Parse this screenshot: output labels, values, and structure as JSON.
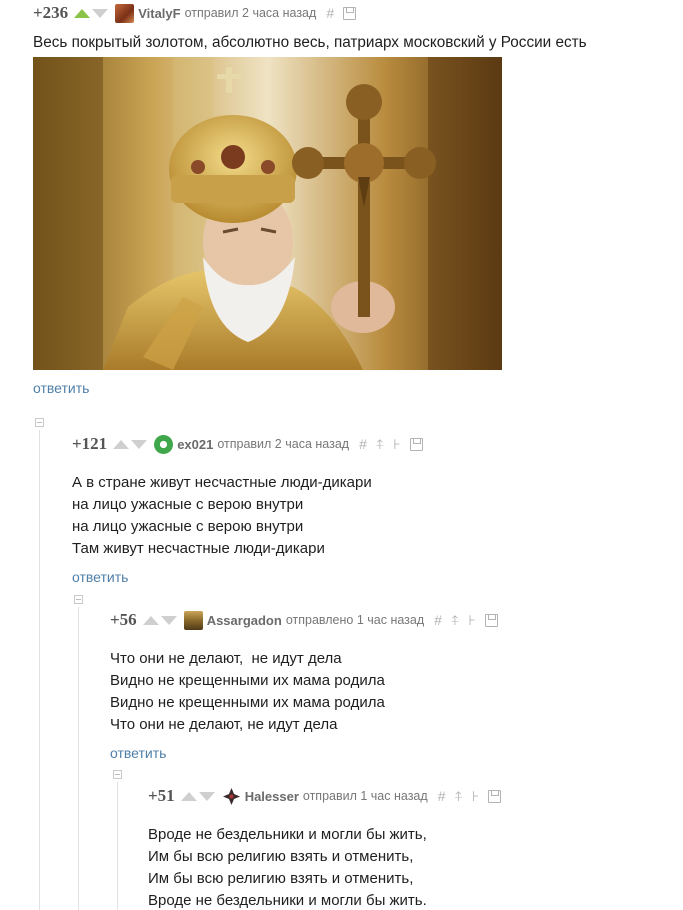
{
  "comments": [
    {
      "rating": "+236",
      "user": "VitalyF",
      "meta": "отправил 2 часа назад",
      "lines": [
        "Весь покрытый золотом, абсолютно весь, патриарх московский у России есть"
      ],
      "reply": "ответить"
    },
    {
      "rating": "+121",
      "user": "ex021",
      "meta": "отправил 2 часа назад",
      "lines": [
        "А в стране живут несчастные люди-дикари",
        "на лицо ужасные с верою внутри",
        "на лицо ужасные с верою внутри",
        "Там живут несчастные люди-дикари"
      ],
      "reply": "ответить"
    },
    {
      "rating": "+56",
      "user": "Assargadon",
      "meta": "отправлено 1 час назад",
      "lines": [
        "Что они не делают,  не идут дела",
        "Видно не крещенными их мама родила",
        "Видно не крещенными их мама родила",
        "Что они не делают, не идут дела"
      ],
      "reply": "ответить"
    },
    {
      "rating": "+51",
      "user": "Halesser",
      "meta": "отправил 1 час назад",
      "lines": [
        "Вроде не бездельники и могли бы жить,",
        "Им бы всю религию взять и отменить,",
        "Им бы всю религию взять и отменить,",
        "Вроде не бездельники и могли бы жить."
      ]
    }
  ],
  "icons": {
    "hash": "#",
    "pin": "⍏",
    "tree": "⊦",
    "save": "save-icon"
  },
  "colors": {
    "upvote_active": "#8bc34a",
    "link": "#4f7fa8",
    "text": "#1f1f1f"
  }
}
